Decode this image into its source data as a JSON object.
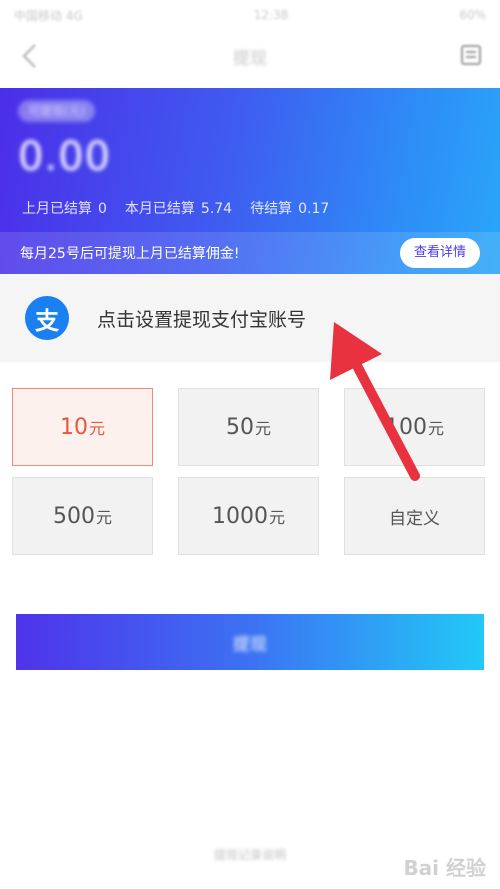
{
  "status_bar": {
    "carrier": "中国移动 4G",
    "time": "12:38",
    "battery": "60%"
  },
  "nav": {
    "title": "提现"
  },
  "balance_card": {
    "label": "可提现(元)",
    "amount": "0.00",
    "settle": [
      {
        "label": "上月已结算",
        "value": "0"
      },
      {
        "label": "本月已结算",
        "value": "5.74"
      },
      {
        "label": "待结算",
        "value": "0.17"
      }
    ],
    "notice": "每月25号后可提现上月已结算佣金!",
    "detail_button": "查看详情"
  },
  "alipay": {
    "icon_glyph": "支",
    "label": "点击设置提现支付宝账号"
  },
  "amount_options": [
    {
      "value": "10",
      "unit": "元",
      "selected": true
    },
    {
      "value": "50",
      "unit": "元",
      "selected": false
    },
    {
      "value": "100",
      "unit": "元",
      "selected": false
    },
    {
      "value": "500",
      "unit": "元",
      "selected": false
    },
    {
      "value": "1000",
      "unit": "元",
      "selected": false
    }
  ],
  "custom_option": "自定义",
  "withdraw_button": "提现",
  "footer": "提现记录说明",
  "watermark": "Bai 经验",
  "colors": {
    "accent": "#4c2ee8",
    "selected_border": "#ef8a74",
    "arrow": "#e8323f"
  }
}
